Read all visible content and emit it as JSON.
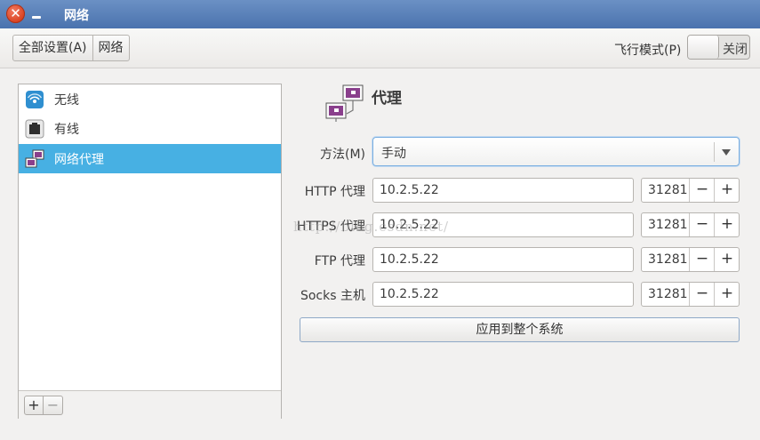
{
  "window": {
    "title": "网络"
  },
  "toolbar": {
    "all_settings": "全部设置(A)",
    "current_panel": "网络",
    "airplane_label": "飞行模式(P)",
    "airplane_state": "关闭"
  },
  "sidebar": {
    "items": [
      {
        "label": "无线",
        "icon": "wireless-icon"
      },
      {
        "label": "有线",
        "icon": "wired-icon"
      },
      {
        "label": "网络代理",
        "icon": "network-proxy-icon",
        "selected": true
      }
    ],
    "add_label": "+",
    "remove_label": "−"
  },
  "proxy": {
    "title": "代理",
    "method_label": "方法(M)",
    "method_value": "手动",
    "rows": [
      {
        "label": "HTTP 代理",
        "host": "10.2.5.22",
        "port": "31281"
      },
      {
        "label": "HTTPS 代理",
        "host": "10.2.5.22",
        "port": "31281"
      },
      {
        "label": "FTP 代理",
        "host": "10.2.5.22",
        "port": "31281"
      },
      {
        "label": "Socks 主机",
        "host": "10.2.5.22",
        "port": "31281"
      }
    ],
    "minus_label": "−",
    "plus_label": "+",
    "apply_label": "应用到整个系统"
  },
  "watermark": "http://blog.csdn.net/",
  "colors": {
    "titlebar": "#5580b8",
    "selection": "#47b0e3",
    "close": "#d9411f"
  }
}
